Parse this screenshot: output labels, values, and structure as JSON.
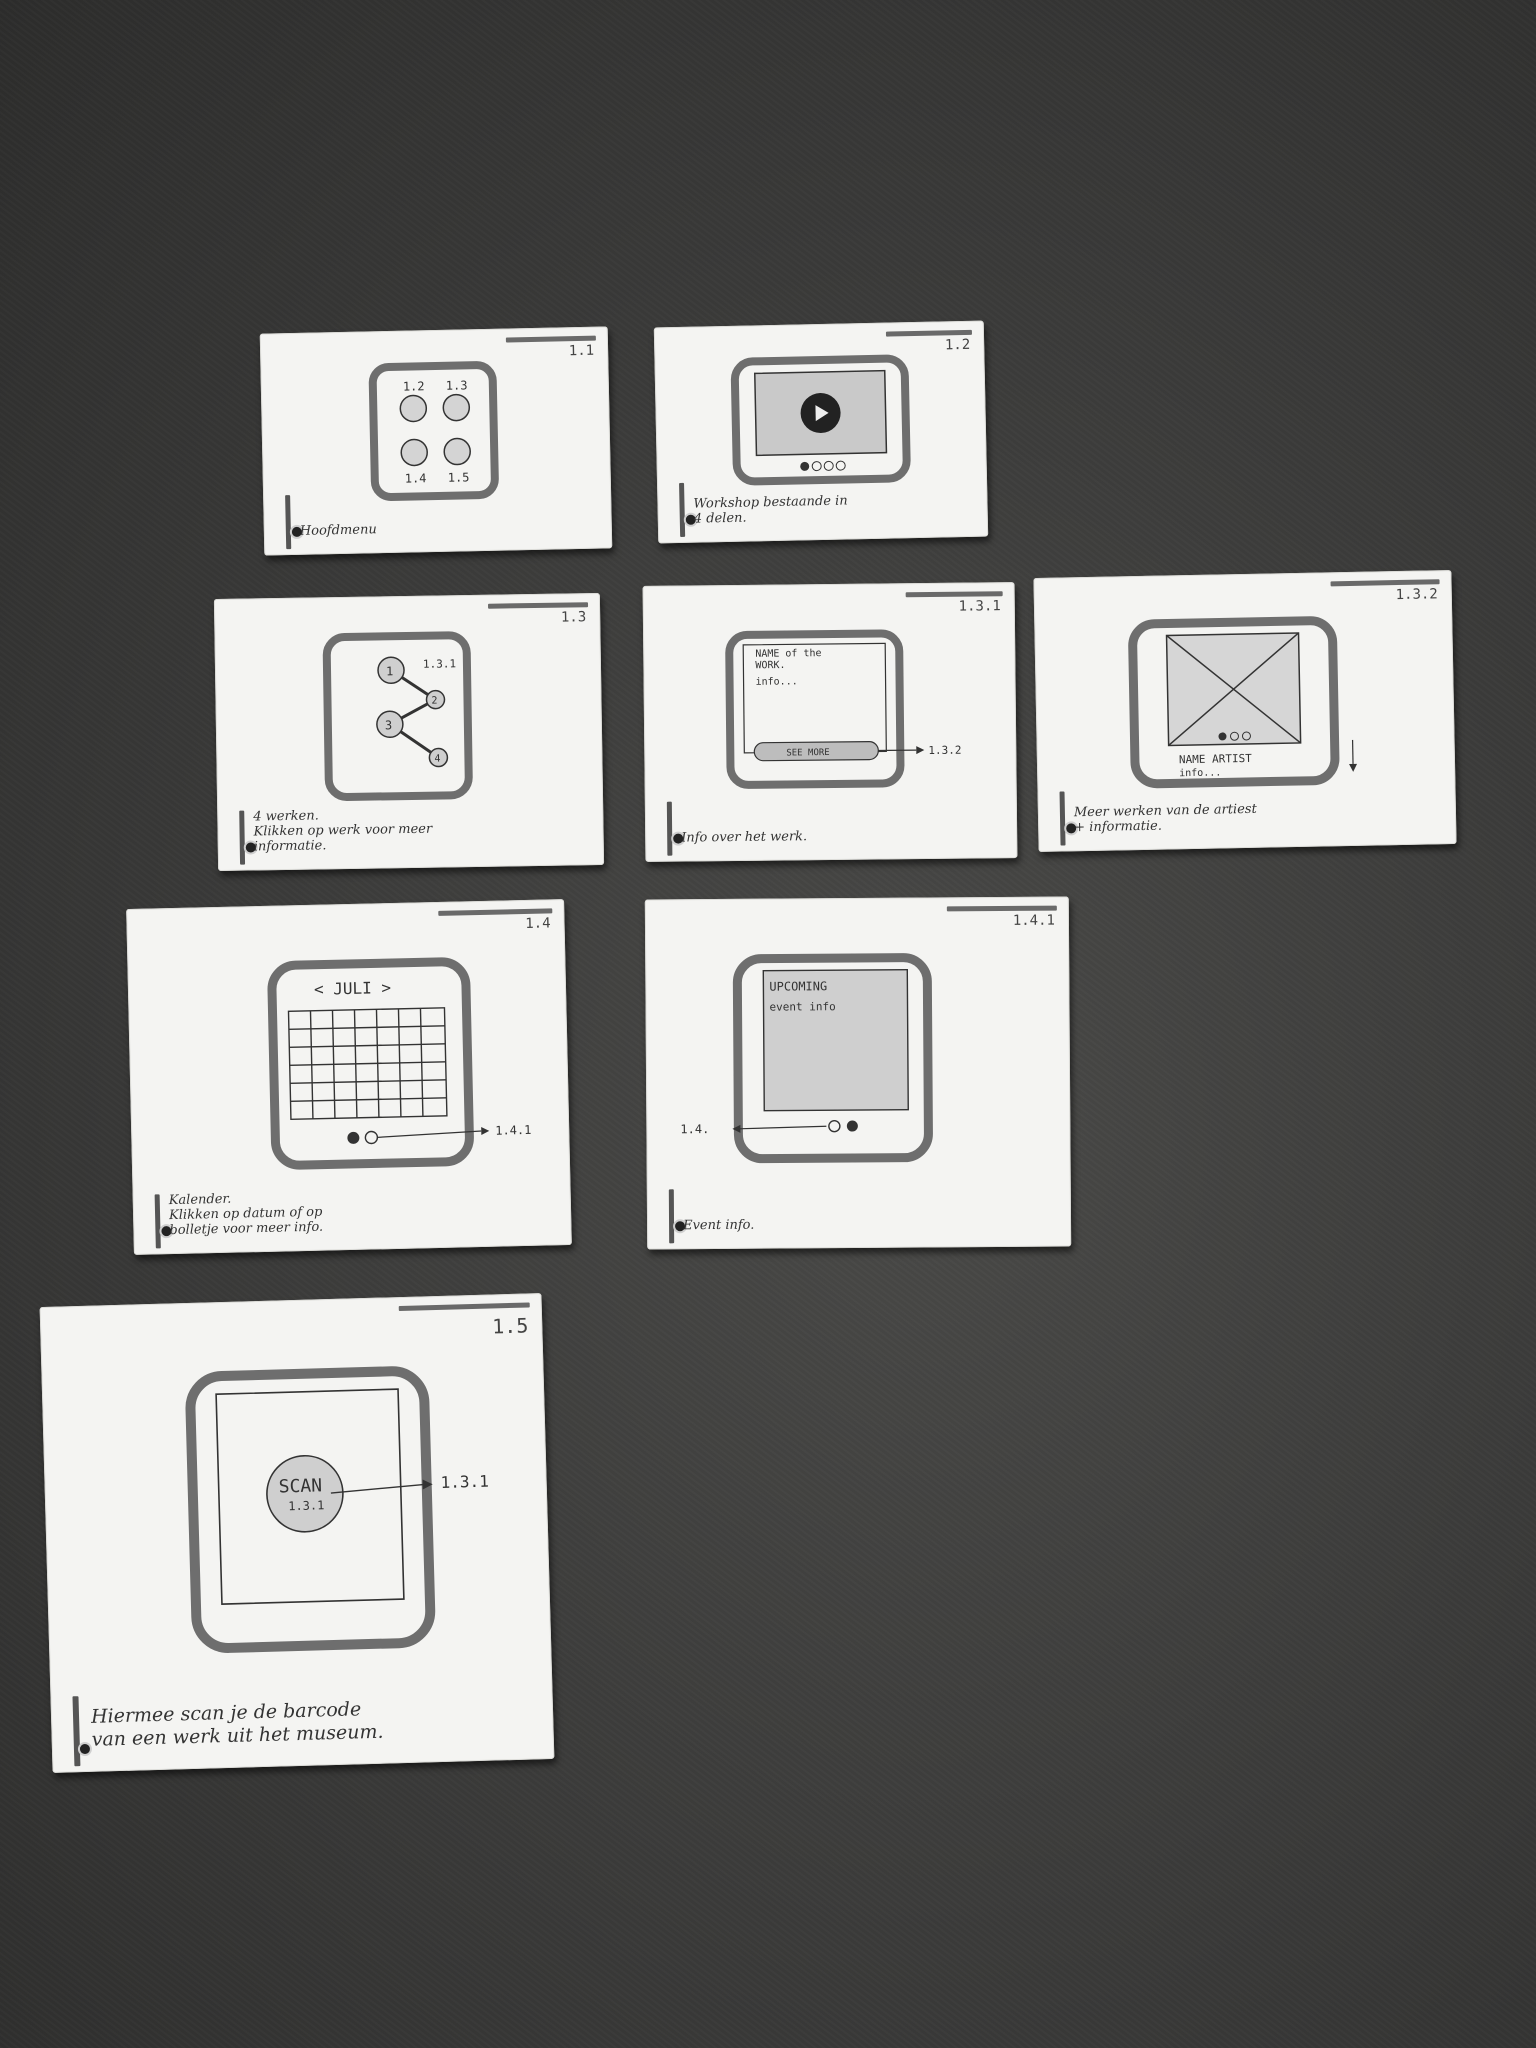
{
  "cards": [
    {
      "id": "1.1",
      "caption": "Hoofdmenu",
      "icons": [
        "1.2",
        "1.3",
        "1.4",
        "1.5"
      ]
    },
    {
      "id": "1.2",
      "caption": "Workshop bestaande in\n4 delen."
    },
    {
      "id": "1.3",
      "caption": "4 werken.\nKlikken op werk voor meer\ninformatie.",
      "nodes": [
        "1",
        "2",
        "3",
        "4"
      ],
      "link": "1.3.1"
    },
    {
      "id": "1.3.1",
      "caption": "Info over het werk.",
      "title": "NAME of the\nWORK.",
      "info": "info...",
      "button": "SEE MORE",
      "link": "1.3.2"
    },
    {
      "id": "1.3.2",
      "caption": "Meer werken van de artiest\n+ informatie.",
      "name": "NAME ARTIST",
      "info": "info..."
    },
    {
      "id": "1.4",
      "caption": "Kalender.\nKlikken op datum of op\nbolletje voor meer info.",
      "month": "< JULI >",
      "link": "1.4.1"
    },
    {
      "id": "1.4.1",
      "caption": "Event info.",
      "heading": "UPCOMING",
      "info": "event info",
      "link": "1.4."
    },
    {
      "id": "1.5",
      "caption": "Hiermee scan je de barcode\nvan een werk uit het museum.",
      "button": "SCAN",
      "button_sub": "1.3.1",
      "link": "1.3.1"
    }
  ]
}
